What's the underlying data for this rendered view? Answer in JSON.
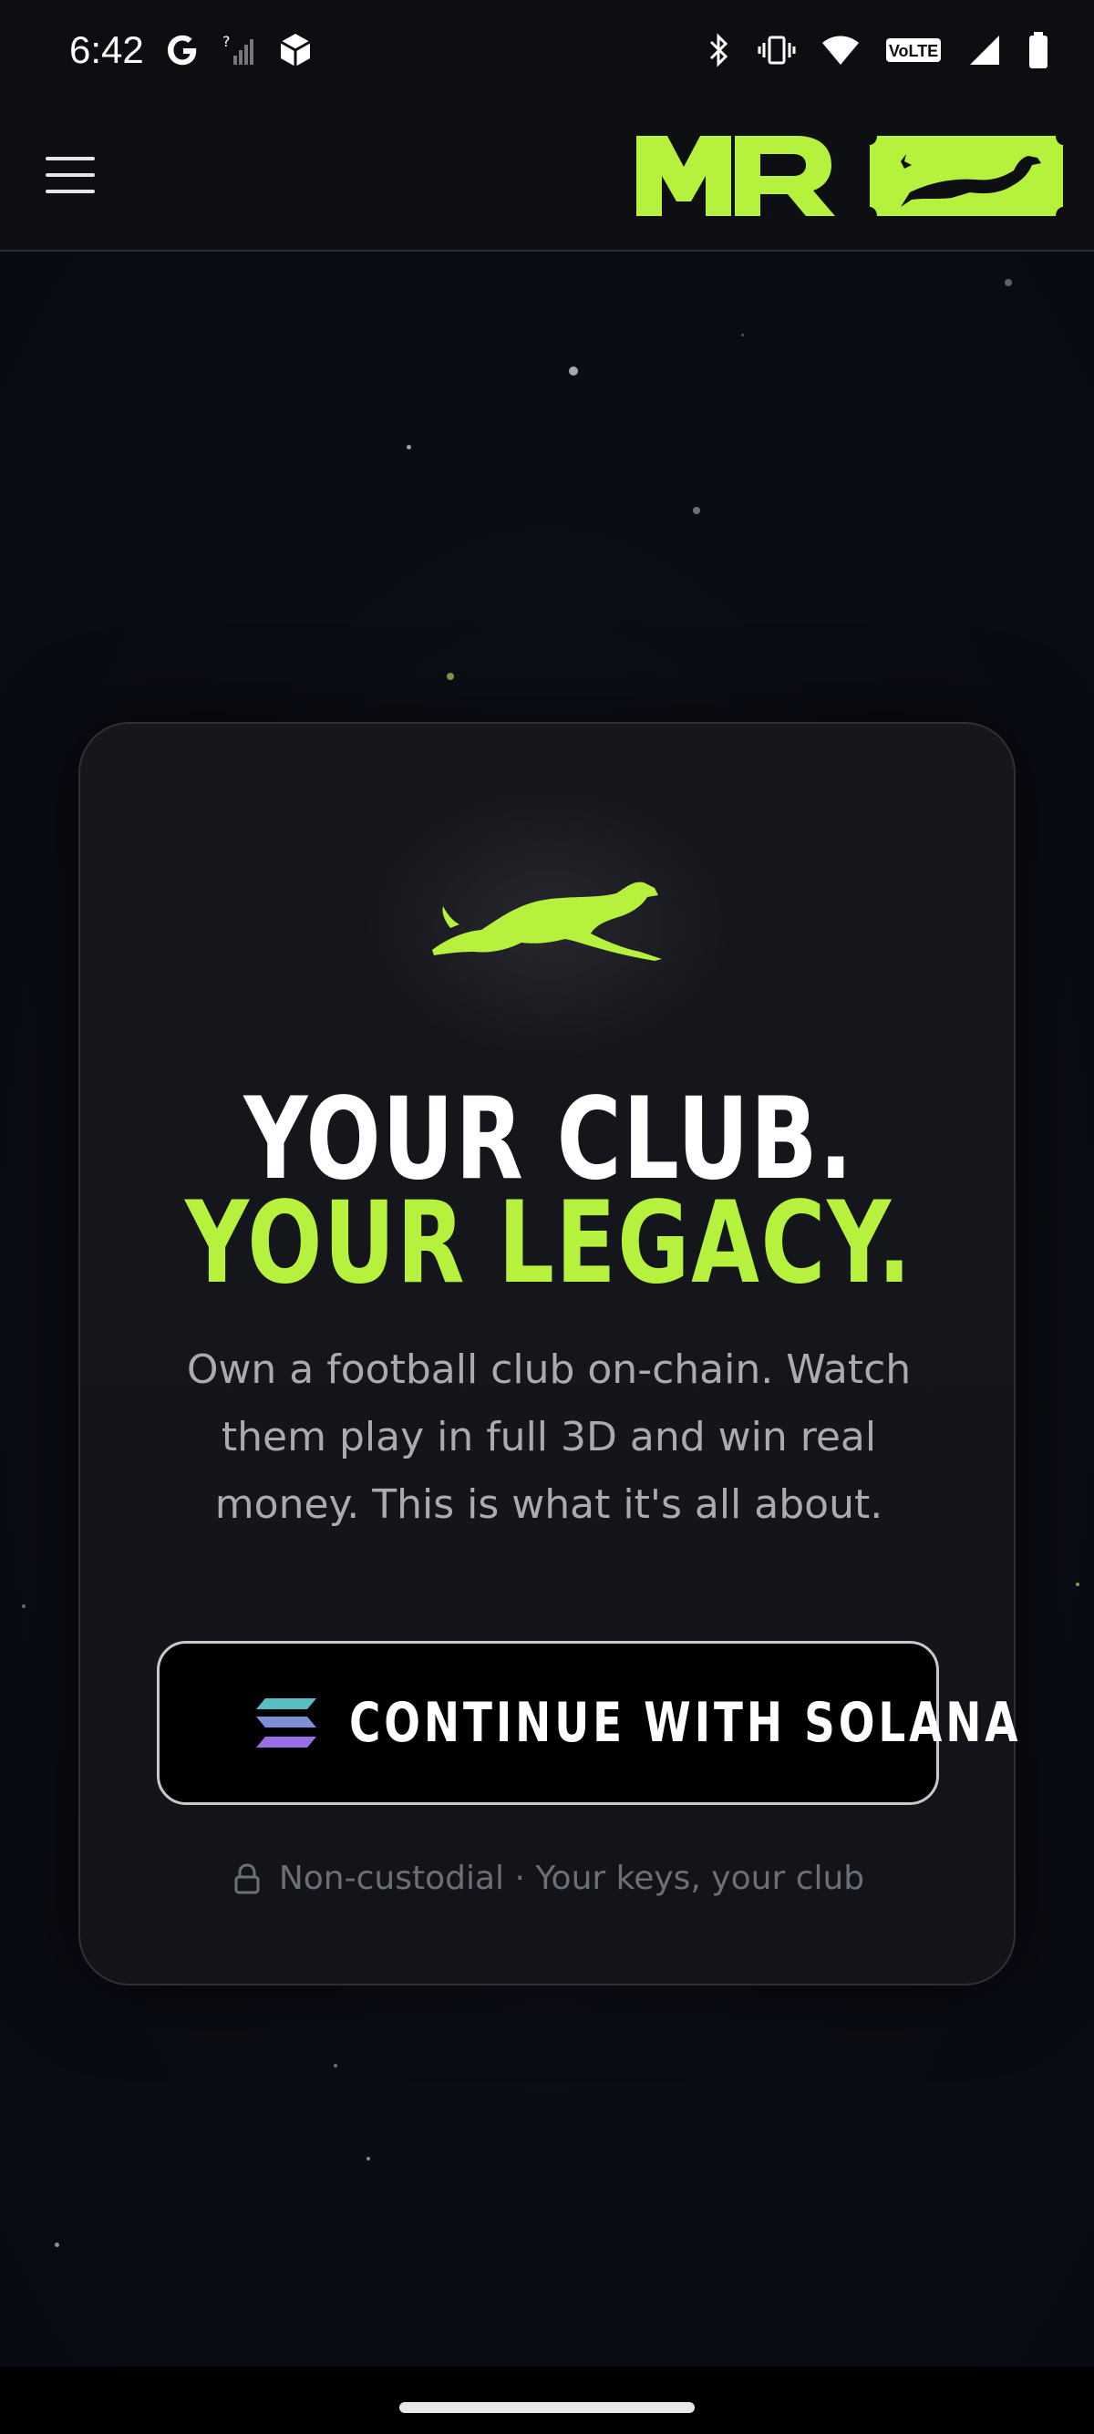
{
  "status_bar": {
    "time": "6:42",
    "left_icons": [
      "google-icon",
      "signal-unknown-icon",
      "app-cube-icon"
    ],
    "right_icons": [
      "bluetooth-icon",
      "vibrate-icon",
      "wifi-icon",
      "volte-icon",
      "cell-signal-icon",
      "battery-icon"
    ],
    "volte_label": "VoLTE"
  },
  "header": {
    "menu_icon": "hamburger-icon",
    "logo_text": "MR",
    "accent_color": "#b6f23d"
  },
  "card": {
    "mascot_icon": "greyhound-icon",
    "headline_line1": "YOUR CLUB.",
    "headline_line2": "YOUR LEGACY.",
    "description": "Own a football club on-chain. Watch them play in full 3D and win real money. This is what it's all about.",
    "cta": {
      "label": "CONTINUE WITH SOLANA",
      "icon": "solana-icon"
    },
    "footnote": {
      "icon": "lock-icon",
      "text": "Non-custodial · Your keys, your club"
    }
  },
  "colors": {
    "background": "#0b0d14",
    "accent": "#b6f23d",
    "text_muted": "#a9abb0",
    "cta_border": "#c9c9cc"
  }
}
